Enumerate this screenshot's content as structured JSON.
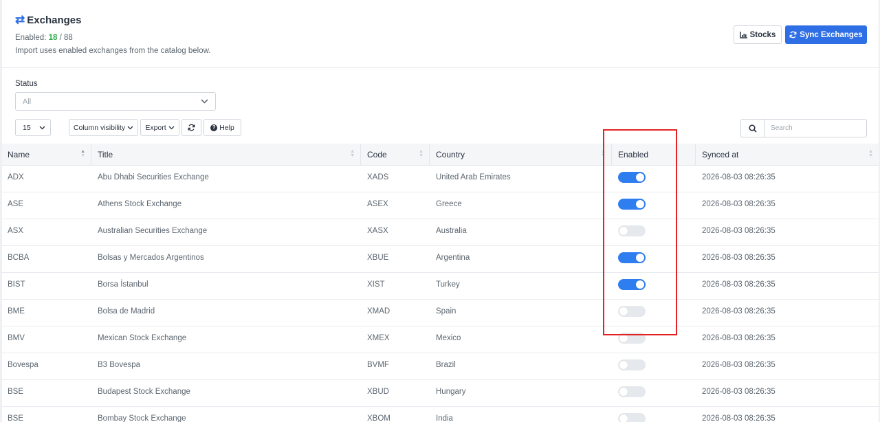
{
  "header": {
    "title": "Exchanges",
    "enabled_prefix": "Enabled:",
    "enabled_count": "18",
    "enabled_total": "/ 88",
    "subtitle": "Import uses enabled exchanges from the catalog below.",
    "stocks_label": "Stocks",
    "sync_label": "Sync Exchanges"
  },
  "filters": {
    "status_label": "Status",
    "status_value": "All"
  },
  "toolbar": {
    "page_size": "15",
    "column_visibility_label": "Column visibility",
    "export_label": "Export",
    "help_label": "Help",
    "search_placeholder": "Search"
  },
  "table": {
    "columns": [
      "Name",
      "Title",
      "Code",
      "Country",
      "Enabled",
      "Synced at"
    ],
    "rows": [
      {
        "name": "ADX",
        "title": "Abu Dhabi Securities Exchange",
        "code": "XADS",
        "country": "United Arab Emirates",
        "enabled": true,
        "synced_at": "2026-08-03 08:26:35"
      },
      {
        "name": "ASE",
        "title": "Athens Stock Exchange",
        "code": "ASEX",
        "country": "Greece",
        "enabled": true,
        "synced_at": "2026-08-03 08:26:35"
      },
      {
        "name": "ASX",
        "title": "Australian Securities Exchange",
        "code": "XASX",
        "country": "Australia",
        "enabled": false,
        "synced_at": "2026-08-03 08:26:35"
      },
      {
        "name": "BCBA",
        "title": "Bolsas y Mercados Argentinos",
        "code": "XBUE",
        "country": "Argentina",
        "enabled": true,
        "synced_at": "2026-08-03 08:26:35"
      },
      {
        "name": "BIST",
        "title": "Borsa İstanbul",
        "code": "XIST",
        "country": "Turkey",
        "enabled": true,
        "synced_at": "2026-08-03 08:26:35"
      },
      {
        "name": "BME",
        "title": "Bolsa de Madrid",
        "code": "XMAD",
        "country": "Spain",
        "enabled": false,
        "synced_at": "2026-08-03 08:26:35"
      },
      {
        "name": "BMV",
        "title": "Mexican Stock Exchange",
        "code": "XMEX",
        "country": "Mexico",
        "enabled": false,
        "synced_at": "2026-08-03 08:26:35"
      },
      {
        "name": "Bovespa",
        "title": "B3 Bovespa",
        "code": "BVMF",
        "country": "Brazil",
        "enabled": false,
        "synced_at": "2026-08-03 08:26:35"
      },
      {
        "name": "BSE",
        "title": "Budapest Stock Exchange",
        "code": "XBUD",
        "country": "Hungary",
        "enabled": false,
        "synced_at": "2026-08-03 08:26:35"
      },
      {
        "name": "BSE",
        "title": "Bombay Stock Exchange",
        "code": "XBOM",
        "country": "India",
        "enabled": false,
        "synced_at": "2026-08-03 08:26:35"
      }
    ]
  },
  "colors": {
    "accent": "#2f6fe6",
    "toggle_on": "#2f7ef0",
    "enabled_count": "#2eaa4a",
    "highlight": "#e52222"
  },
  "icons": {
    "title": "arrows-exchange-icon",
    "stocks": "chart-bar-icon",
    "sync": "sync-icon",
    "refresh": "refresh-icon",
    "help": "question-circle-icon",
    "search": "search-icon"
  }
}
